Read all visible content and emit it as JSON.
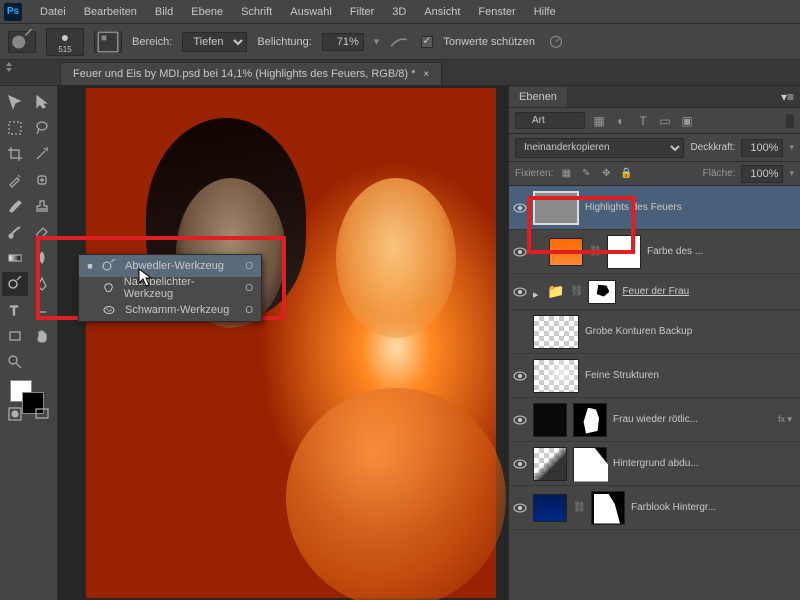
{
  "app": {
    "logo": "Ps"
  },
  "menu": [
    "Datei",
    "Bearbeiten",
    "Bild",
    "Ebene",
    "Schrift",
    "Auswahl",
    "Filter",
    "3D",
    "Ansicht",
    "Fenster",
    "Hilfe"
  ],
  "options": {
    "brush_size": "515",
    "range_label": "Bereich:",
    "range_value": "Tiefen",
    "exposure_label": "Belichtung:",
    "exposure_value": "71%",
    "protect_label": "Tonwerte schützen"
  },
  "document": {
    "tab_title": "Feuer und Eis by MDI.psd bei 14,1% (Highlights des Feuers, RGB/8) *"
  },
  "flyout": {
    "items": [
      {
        "label": "Abwedler-Werkzeug",
        "key": "O",
        "selected": true
      },
      {
        "label": "Nachbelichter-Werkzeug",
        "key": "O",
        "selected": false
      },
      {
        "label": "Schwamm-Werkzeug",
        "key": "O",
        "selected": false
      }
    ]
  },
  "layers_panel": {
    "tab": "Ebenen",
    "search_placeholder": "Art",
    "blend_mode": "Ineinanderkopieren",
    "opacity_label": "Deckkraft:",
    "opacity_value": "100%",
    "lock_label": "Fixieren:",
    "fill_label": "Fläche:",
    "fill_value": "100%",
    "layers": [
      {
        "name": "Highlights des Feuers",
        "selected": true,
        "visible": true,
        "thumb": "gray"
      },
      {
        "name": "Farbe des ...",
        "visible": true,
        "thumb": "orange",
        "mask": "white",
        "linked": true
      },
      {
        "name": "Feuer der Frau",
        "visible": true,
        "group": true,
        "underline": true,
        "thumb": "group"
      },
      {
        "name": "Grobe Konturen Backup",
        "visible": false,
        "thumb": "trans"
      },
      {
        "name": "Feine Strukturen",
        "visible": true,
        "thumb": "trans"
      },
      {
        "name": "Frau wieder rötlic...",
        "visible": true,
        "thumb": "dark",
        "mask": "shape1",
        "fx": true
      },
      {
        "name": "Hintergrund abdu...",
        "visible": true,
        "thumb": "trans2",
        "mask": "shape2"
      },
      {
        "name": "Farblook Hintergr...",
        "visible": true,
        "thumb": "blue",
        "mask": "shape3",
        "linked": true
      }
    ]
  }
}
